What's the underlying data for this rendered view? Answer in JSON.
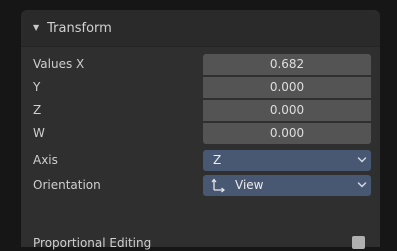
{
  "panel": {
    "title": "Transform",
    "collapse_state": "expanded"
  },
  "values": {
    "x_label": "Values X",
    "x_value": "0.682",
    "y_label": "Y",
    "y_value": "0.000",
    "z_label": "Z",
    "z_value": "0.000",
    "w_label": "W",
    "w_value": "0.000"
  },
  "axis": {
    "label": "Axis",
    "selected": "Z"
  },
  "orientation": {
    "label": "Orientation",
    "selected": "View",
    "icon": "orientation-view-icon"
  },
  "proportional_editing": {
    "label": "Proportional Editing",
    "checked": false
  },
  "colors": {
    "panel_bg": "#2f2f2f",
    "field_bg": "#545454",
    "dropdown_bg": "#485872",
    "checkbox": "#b0b0b0"
  }
}
